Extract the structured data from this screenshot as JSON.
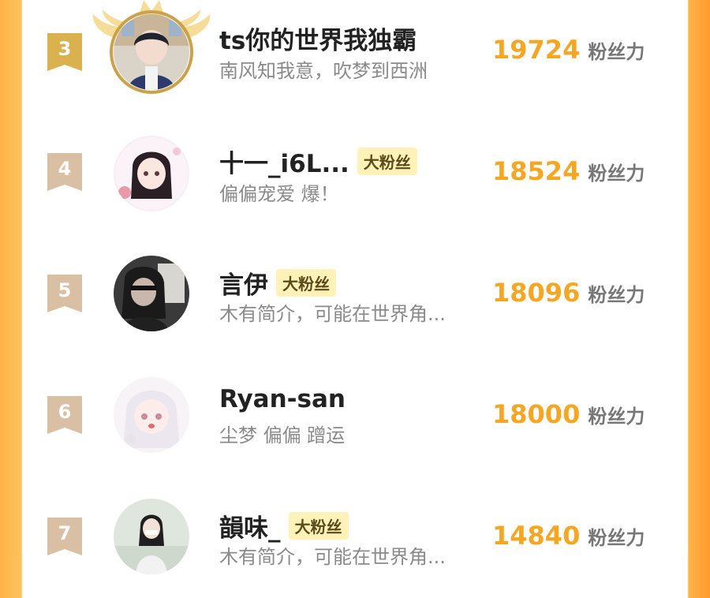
{
  "rows": [
    {
      "rank": "3",
      "name": "ts你的世界我独霸",
      "tag": "",
      "bio": "南风知我意，吹梦到西洲",
      "score": "19724",
      "unit": "粉丝力",
      "highlight": true
    },
    {
      "rank": "4",
      "name": "十一_i6L...",
      "tag": "大粉丝",
      "bio": "偏偏宠爱 爆！",
      "score": "18524",
      "unit": "粉丝力",
      "highlight": false
    },
    {
      "rank": "5",
      "name": "言伊",
      "tag": "大粉丝",
      "bio": "木有简介，可能在世界角...",
      "score": "18096",
      "unit": "粉丝力",
      "highlight": false
    },
    {
      "rank": "6",
      "name": "Ryan-san",
      "tag": "",
      "bio": "尘梦 偏偏 蹭运",
      "score": "18000",
      "unit": "粉丝力",
      "highlight": false
    },
    {
      "rank": "7",
      "name": "韻味_",
      "tag": "大粉丝",
      "bio": "木有简介，可能在世界角...",
      "score": "14840",
      "unit": "粉丝力",
      "highlight": false
    }
  ],
  "colors": {
    "gold_badge": "#d9b24f",
    "bronze_badge": "#d9bfa3",
    "accent": "#f5a623",
    "frame_orange": "#ffb347"
  },
  "icons": {
    "crown": "crown-wings-icon"
  }
}
